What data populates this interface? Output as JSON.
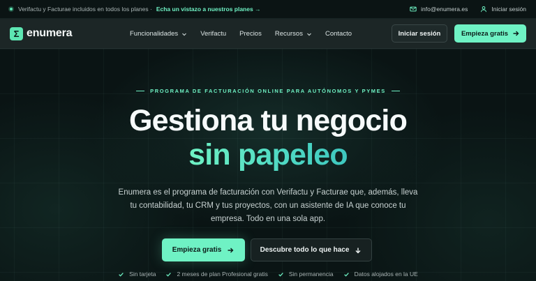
{
  "topbar": {
    "announcement": "Verifactu y Facturae incluidos en todos los planes ·",
    "link": "Echa un vistazo a nuestros planes →",
    "email": "info@enumera.es",
    "login": "Iniciar sesión"
  },
  "nav": {
    "logo_mark": "Σ",
    "logo_text": "enumera",
    "items": [
      {
        "label": "Funcionalidades",
        "dropdown": true
      },
      {
        "label": "Verifactu",
        "dropdown": false
      },
      {
        "label": "Precios",
        "dropdown": false
      },
      {
        "label": "Recursos",
        "dropdown": true
      },
      {
        "label": "Contacto",
        "dropdown": false
      }
    ],
    "login_button": "Iniciar sesión",
    "start_button": "Empieza gratis"
  },
  "hero": {
    "eyebrow": "PROGRAMA DE FACTURACIÓN ONLINE PARA AUTÓNOMOS Y PYMES",
    "headline_line1": "Gestiona tu negocio",
    "headline_line2": "sin papeleo",
    "description": "Enumera es el programa de facturación con Verifactu y Facturae que, además, lleva tu contabilidad, tu CRM y tus proyectos, con un asistente de IA que conoce tu empresa. Todo en una sola app.",
    "primary_cta": "Empieza gratis",
    "secondary_cta": "Descubre todo lo que hace",
    "checks": [
      "Sin tarjeta",
      "2 meses de plan Profesional gratis",
      "Sin permanencia",
      "Datos alojados en la UE"
    ]
  },
  "colors": {
    "accent": "#6ff2c4",
    "background": "#0a1414",
    "nav_background": "#1c2626"
  }
}
